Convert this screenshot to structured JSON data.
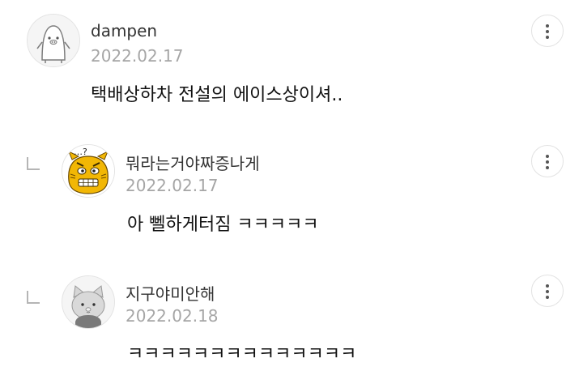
{
  "comments": [
    {
      "author": "dampen",
      "date": "2022.02.17",
      "text": "택배상하차 전설의 에이스상이셔..",
      "avatar_icon": "penguin-avatar",
      "menu_icon": "more-vertical-icon"
    },
    {
      "author": "뭐라는거야짜증나게",
      "date": "2022.02.17",
      "text": "아 뻴하게터짐 ㅋㅋㅋㅋㅋ",
      "avatar_icon": "annoyed-tiger-avatar",
      "menu_icon": "more-vertical-icon"
    },
    {
      "author": "지구야미안해",
      "date": "2022.02.18",
      "text": "ㅋㅋㅋㅋㅋㅋㅋㅋㅋㅋㅋㅋㅋㅋ",
      "avatar_icon": "gray-cat-avatar",
      "menu_icon": "more-vertical-icon"
    }
  ],
  "colors": {
    "name": "#333333",
    "date": "#a6a6a6",
    "text": "#111111",
    "border": "#e2e2e2",
    "tiger": "#f2b705"
  }
}
